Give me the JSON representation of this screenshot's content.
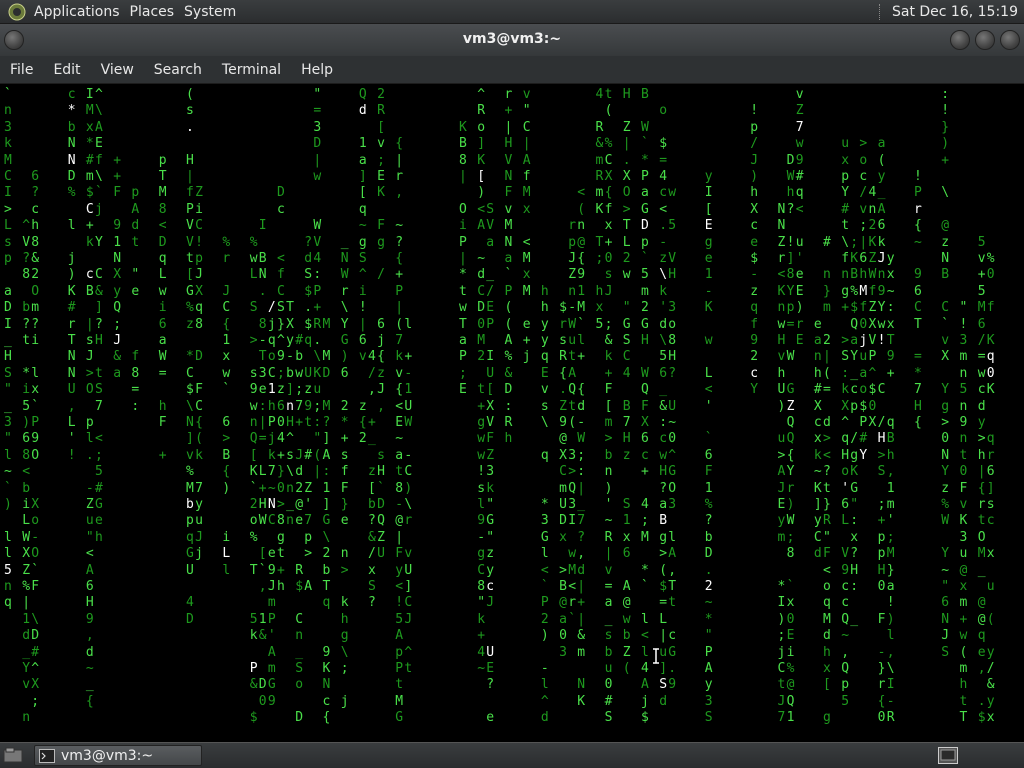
{
  "panel": {
    "menus": [
      "Applications",
      "Places",
      "System"
    ],
    "clock": "Sat Dec 16, 15:19"
  },
  "window": {
    "title": "vm3@vm3:~",
    "menu": [
      "File",
      "Edit",
      "View",
      "Search",
      "Terminal",
      "Help"
    ]
  },
  "terminal": {
    "program": "matrix",
    "charset": "!\"#$%&'()*+,-./0123456789:;<=>?@ABCDEFGHIJKLMNOPQRSTUVWXYZ[\\]^_`abcdefghijklmnopqrstuvwxyz{|}~",
    "highlight_chars": [
      "5",
      "*",
      "N",
      "C",
      "c",
      "J",
      ".",
      "b",
      "L",
      "P",
      "/",
      "1",
      "N",
      "n",
      "d",
      "[",
      "c",
      "U",
      "D",
      "\\",
      "B",
      "S",
      "E",
      "2",
      "c",
      "Z",
      "7",
      "'",
      "M",
      "j",
      "Y",
      "J",
      "!",
      "H",
      "r",
      "q",
      "0",
      "H",
      "P",
      "Q",
      "I",
      "K",
      "w"
    ],
    "colors": {
      "dim": "#1e9a1e",
      "bright": "#4ae04a",
      "highlight": "#ffffff"
    }
  },
  "taskbar": {
    "task_label": "vm3@vm3:~"
  },
  "icons": {
    "panel_logo": "gnome-foot-icon",
    "show_desktop": "show-desktop-icon",
    "task": "terminal-icon",
    "workspace": "workspace-switcher-icon"
  }
}
